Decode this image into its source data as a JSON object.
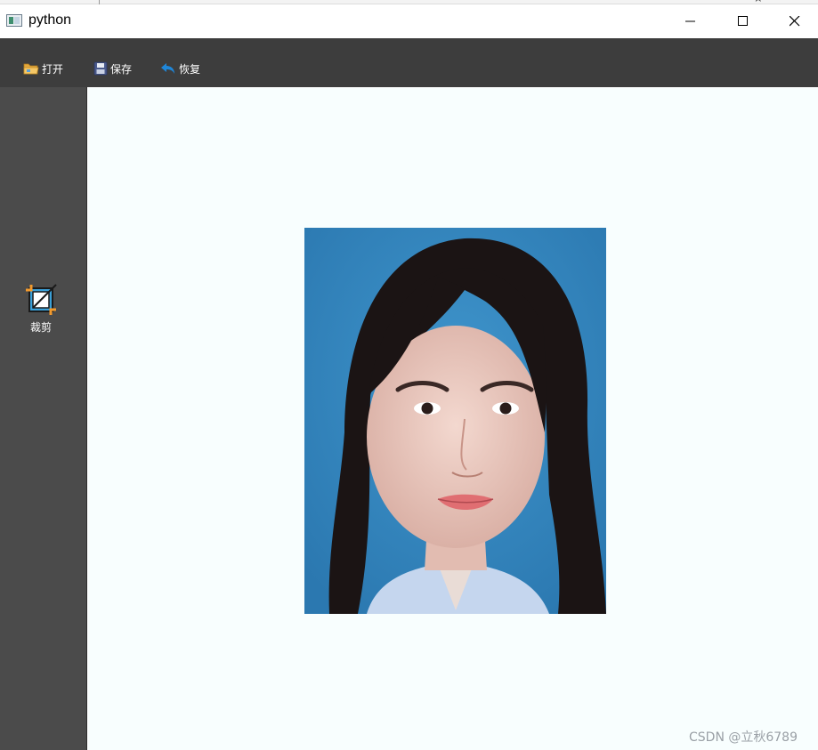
{
  "window": {
    "title": "python",
    "icon": "python-app-icon",
    "controls": [
      "minimize-icon",
      "maximize-icon",
      "close-icon"
    ]
  },
  "toolbar": {
    "open_label": "打开",
    "save_label": "保存",
    "undo_label": "恢复",
    "background": "#3d3d3d"
  },
  "sidebar": {
    "crop_label": "裁剪",
    "background": "#4b4b4b"
  },
  "canvas": {
    "background": "#f8fefe",
    "photo_background": "#3183bb"
  },
  "watermark": "CSDN @立秋6789"
}
